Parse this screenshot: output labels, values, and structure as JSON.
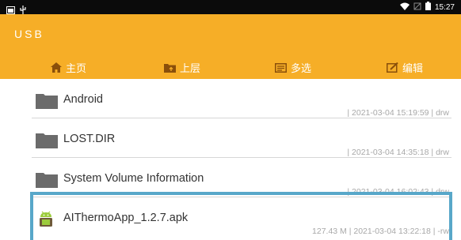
{
  "status_bar": {
    "left_icons": [
      "image-icon",
      "usb-icon"
    ],
    "right_icons": [
      "wifi-icon",
      "screen-icon",
      "battery-icon"
    ],
    "time": "15:27"
  },
  "header": {
    "title": "USB",
    "color": "#f6ae27"
  },
  "toolbar": {
    "home_label": "主页",
    "up_label": "上层",
    "multiselect_label": "多选",
    "edit_label": "编辑"
  },
  "files": [
    {
      "name": "Android",
      "meta": "| 2021-03-04 15:19:59 | drw",
      "icon": "folder-icon"
    },
    {
      "name": "LOST.DIR",
      "meta": "| 2021-03-04 14:35:18 | drw",
      "icon": "folder-icon"
    },
    {
      "name": "System Volume Information",
      "meta": "| 2021-03-04 16:02:43 | drw",
      "icon": "folder-icon"
    },
    {
      "name": "AIThermoApp_1.2.7.apk",
      "meta": "127.43 M | 2021-03-04 13:22:18 | -rw",
      "icon": "android-apk-icon",
      "selected": true
    }
  ],
  "selection_color": "#58a7c9"
}
